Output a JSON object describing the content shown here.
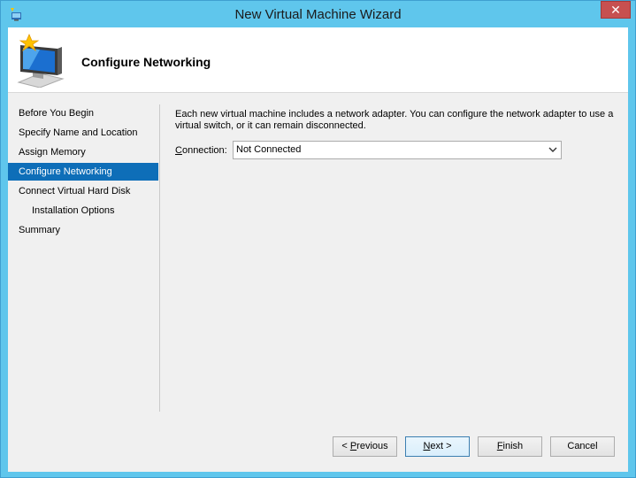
{
  "window": {
    "title": "New Virtual Machine Wizard",
    "close_symbol": "✕"
  },
  "header": {
    "title": "Configure Networking",
    "icon": "computer-star-icon"
  },
  "nav": {
    "items": [
      {
        "label": "Before You Begin",
        "selected": false
      },
      {
        "label": "Specify Name and Location",
        "selected": false
      },
      {
        "label": "Assign Memory",
        "selected": false
      },
      {
        "label": "Configure Networking",
        "selected": true
      },
      {
        "label": "Connect Virtual Hard Disk",
        "selected": false
      },
      {
        "label": "Installation Options",
        "selected": false
      },
      {
        "label": "Summary",
        "selected": false
      }
    ]
  },
  "content": {
    "description_line1": "Each new virtual machine includes a network adapter. You can configure the network adapter to use a",
    "description_line2": "virtual switch, or it can remain disconnected.",
    "connection_label_prefix": "",
    "connection_label_accel": "C",
    "connection_label_rest": "onnection:",
    "connection_value": "Not Connected"
  },
  "buttons": {
    "previous_lt": "< ",
    "previous_accel": "P",
    "previous_rest": "revious",
    "next_accel": "N",
    "next_rest": "ext >",
    "finish_accel": "F",
    "finish_rest": "inish",
    "cancel": "Cancel"
  },
  "colors": {
    "titlebar": "#5fc6ec",
    "selected": "#0e6eb8",
    "close": "#c75050"
  }
}
